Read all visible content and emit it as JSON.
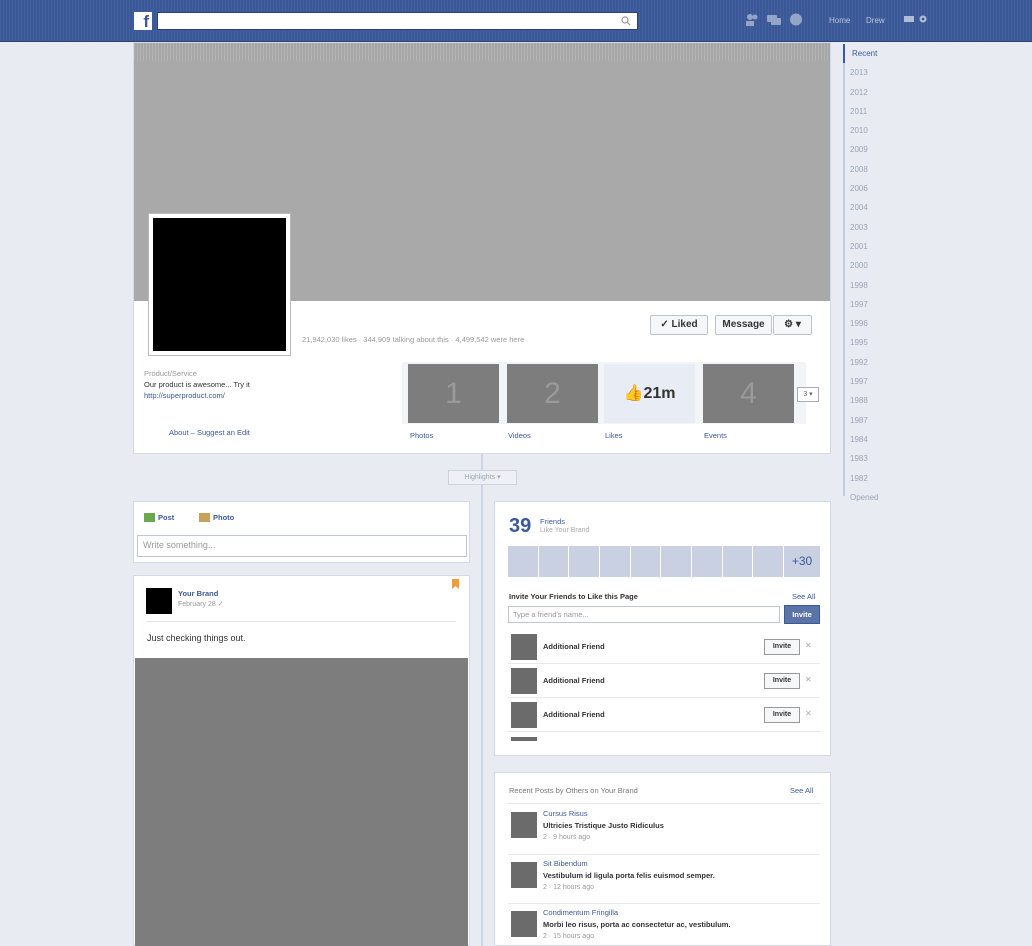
{
  "topbar": {
    "logo": "f",
    "search_placeholder": "",
    "nav_home": "Home",
    "nav_user": "Drew"
  },
  "timeline": {
    "years": [
      "Recent",
      "2013",
      "2012",
      "2011",
      "2010",
      "2009",
      "2008",
      "2006",
      "2004",
      "2003",
      "2001",
      "2000",
      "1998",
      "1997",
      "1996",
      "1995",
      "1992",
      "1997",
      "1988",
      "1987",
      "1984",
      "1983",
      "1982",
      "Opened"
    ]
  },
  "page": {
    "stats": "21,942,030 likes · 344,909 talking about this · 4,499,542 were here",
    "liked_button": "Liked",
    "message_button": "Message",
    "gear_button": "▾",
    "category": "Product/Service",
    "description": "Our product is awesome... Try it",
    "url": "http://superproduct.com/",
    "about_link": "About – Suggest an Edit"
  },
  "apps": [
    {
      "value": "1",
      "label": "Photos"
    },
    {
      "value": "2",
      "label": "Videos"
    },
    {
      "value": "21m",
      "label": "Likes"
    },
    {
      "value": "4",
      "label": "Events"
    }
  ],
  "apps_more": "3 ▾",
  "highlights": "Highlights ▾",
  "composer": {
    "post_tab": "Post",
    "photo_tab": "Photo",
    "placeholder": "Write something..."
  },
  "post": {
    "author": "Your Brand",
    "date": "February 28 ✓",
    "text": "Just checking things out."
  },
  "friends": {
    "count": "39",
    "title": "Friends",
    "subtitle": "Like Your Brand",
    "more": "+30",
    "invite_title": "Invite Your Friends to Like this Page",
    "see_all": "See All",
    "invite_placeholder": "Type a friend's name...",
    "invite_button": "Invite",
    "rows": [
      {
        "name": "Additional Friend",
        "button": "Invite"
      },
      {
        "name": "Additional Friend",
        "button": "Invite"
      },
      {
        "name": "Additional Friend",
        "button": "Invite"
      }
    ]
  },
  "recent": {
    "title": "Recent Posts by Others on Your Brand",
    "see_all": "See All",
    "items": [
      {
        "author": "Cursus Risus",
        "message": "Ultricies Tristique Justo Ridiculus",
        "meta": "2 · 9 hours ago"
      },
      {
        "author": "Sit Bibendum",
        "message": "Vestibulum id ligula porta felis euismod semper.",
        "meta": "2 · 12 hours ago"
      },
      {
        "author": "Condimentum Fringilla",
        "message": "Morbi leo risus, porta ac consectetur ac, vestibulum.",
        "meta": "2 · 15 hours ago"
      }
    ]
  }
}
